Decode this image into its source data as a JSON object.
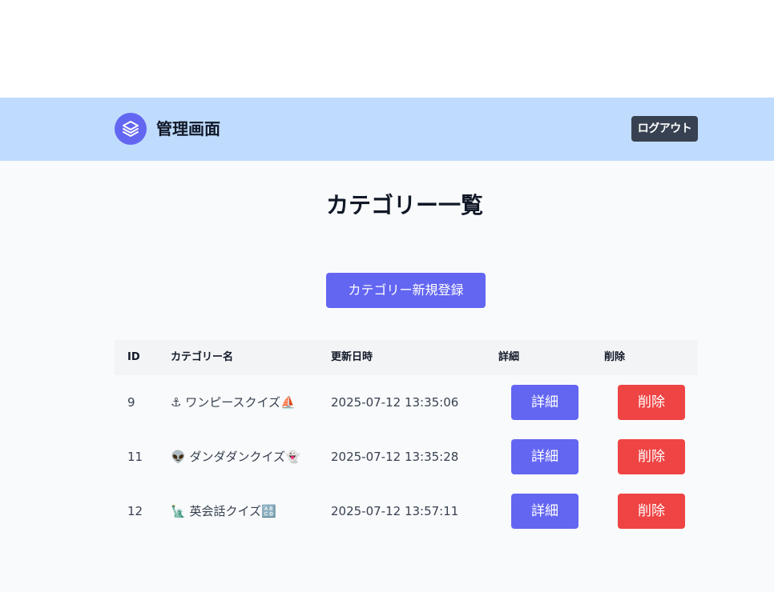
{
  "header": {
    "title": "管理画面",
    "logout_label": "ログアウト",
    "logo_icon": "layers-icon"
  },
  "page": {
    "title": "カテゴリー一覧",
    "new_button_label": "カテゴリー新規登録"
  },
  "table": {
    "columns": [
      "ID",
      "カテゴリー名",
      "更新日時",
      "詳細",
      "削除"
    ],
    "rows": [
      {
        "id": "9",
        "name": "⚓ ワンピースクイズ⛵",
        "updated": "2025-07-12 13:35:06",
        "detail_label": "詳細",
        "delete_label": "削除"
      },
      {
        "id": "11",
        "name": "👽 ダンダダンクイズ👻",
        "updated": "2025-07-12 13:35:28",
        "detail_label": "詳細",
        "delete_label": "削除"
      },
      {
        "id": "12",
        "name": "🗽 英会話クイズ🔠",
        "updated": "2025-07-12 13:57:11",
        "detail_label": "詳細",
        "delete_label": "削除"
      }
    ]
  },
  "colors": {
    "header_bg": "#bfdbfe",
    "primary": "#6366f1",
    "danger": "#ef4444",
    "logout_bg": "#374151"
  }
}
